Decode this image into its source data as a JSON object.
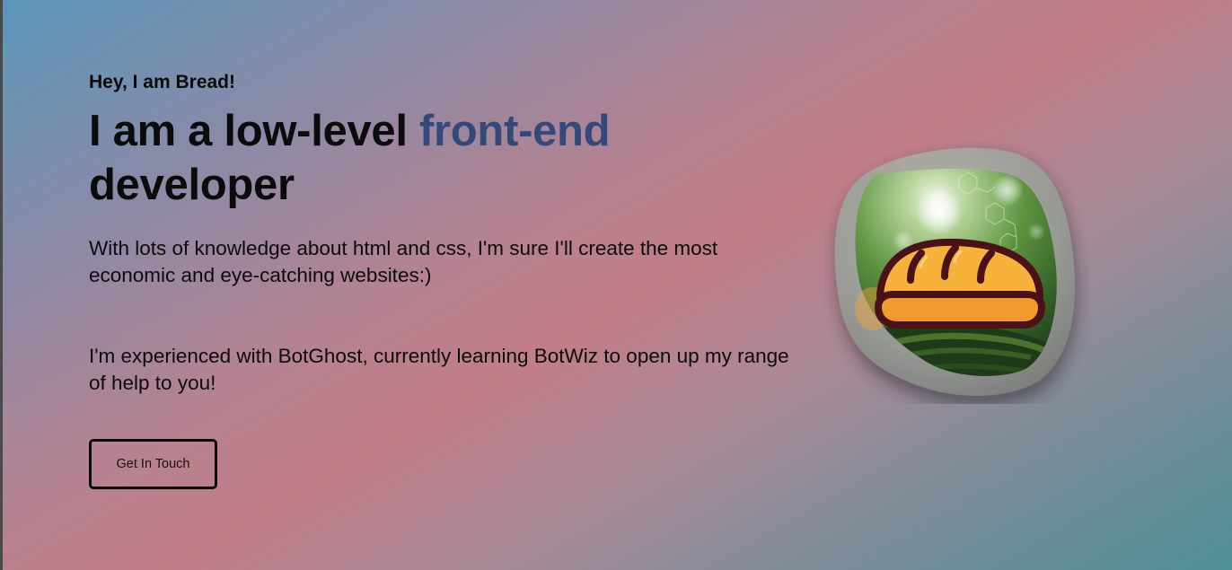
{
  "hero": {
    "greeting": "Hey, I am Bread!",
    "headline_prefix": "I am a low-level",
    "headline_accent": "front-end",
    "headline_suffix": "developer",
    "description": "With lots of knowledge about html and css, I'm sure I'll create the most economic and eye-catching websites:)",
    "experience": "I'm experienced with BotGhost, currently learning BotWiz to open up my range of help to you!",
    "cta_label": "Get In Touch"
  },
  "colors": {
    "accent": "#33497a",
    "text": "#0b0b0b",
    "bread_fill": "#f7b23b",
    "bread_outline": "#4a1218"
  },
  "image": {
    "icon": "bread-icon",
    "background": "forest-moss-photo"
  }
}
